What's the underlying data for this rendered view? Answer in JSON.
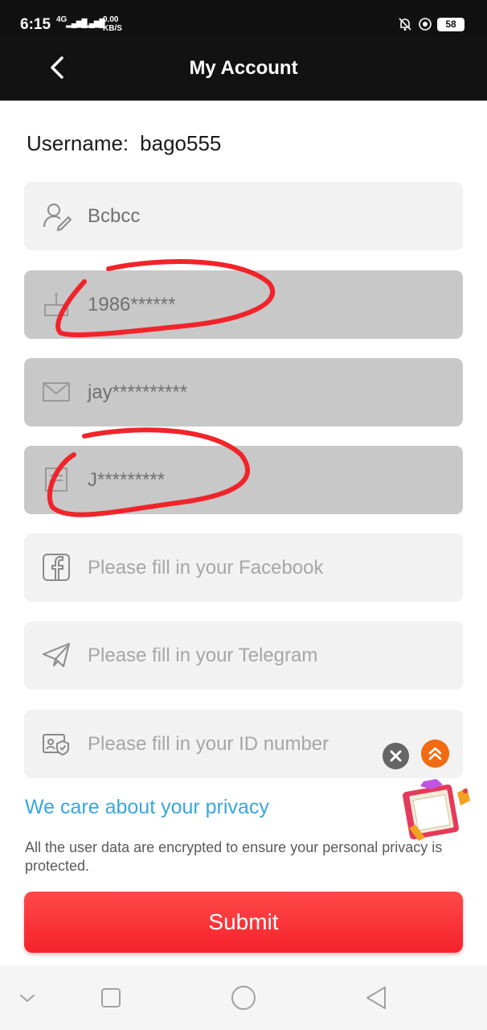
{
  "status_bar": {
    "time": "6:15",
    "network": "4G",
    "speed_value": "0.00",
    "speed_unit": "KB/S",
    "battery": "58"
  },
  "app_bar": {
    "title": "My Account",
    "back_icon": "chevron-left-icon"
  },
  "account": {
    "username_label": "Username:",
    "username_value": "bago555"
  },
  "fields": [
    {
      "icon": "user-edit-icon",
      "value": "Bcbcc",
      "placeholder": "",
      "locked": false
    },
    {
      "icon": "birthday-cake-icon",
      "value": "1986******",
      "placeholder": "",
      "locked": true
    },
    {
      "icon": "envelope-icon",
      "value": "jay**********",
      "placeholder": "",
      "locked": true
    },
    {
      "icon": "document-icon",
      "value": "J*********",
      "placeholder": "",
      "locked": true
    },
    {
      "icon": "facebook-icon",
      "value": "",
      "placeholder": "Please fill in your Facebook",
      "locked": false
    },
    {
      "icon": "telegram-icon",
      "value": "",
      "placeholder": "Please fill in your Telegram",
      "locked": false
    },
    {
      "icon": "id-card-icon",
      "value": "",
      "placeholder": "Please fill in your ID number",
      "locked": false
    }
  ],
  "floating": {
    "close_icon": "close-icon",
    "scroll_top_icon": "double-chevron-up-icon",
    "promo_icon": "gift-box-icon"
  },
  "privacy": {
    "title": "We care about your privacy",
    "text": "All the user data are encrypted to ensure your personal privacy is protected."
  },
  "submit_label": "Submit",
  "colors": {
    "accent_red": "#f5222b",
    "link_blue": "#3aa6dd",
    "scroll_top_orange": "#f26a12",
    "app_bar": "#121212"
  }
}
